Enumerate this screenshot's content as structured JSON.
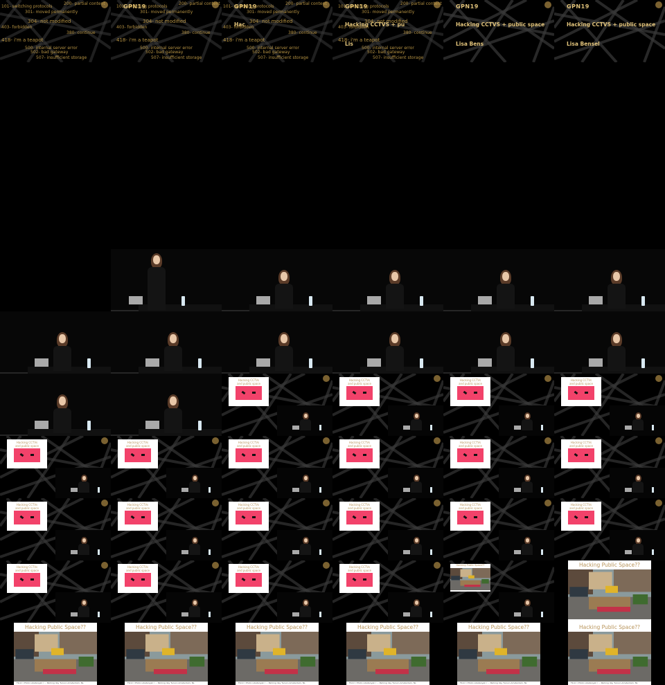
{
  "sheet": {
    "columns": 6,
    "rows": 11
  },
  "title_frames": [
    {
      "gpn": "",
      "line1": "",
      "line2": "",
      "codes": true
    },
    {
      "gpn": "GPN19",
      "line1": "",
      "line2": "",
      "codes": true
    },
    {
      "gpn": "GPN19",
      "line1": "Hac",
      "line2": "",
      "codes": true
    },
    {
      "gpn": "GPN19",
      "line1": "Hacking CCTVS + pu",
      "line2": "Lis",
      "codes": true
    },
    {
      "gpn": "GPN19",
      "line1": "Hacking CCTVS + public space",
      "line2": "Lisa Bens",
      "codes": false
    },
    {
      "gpn": "GPN19",
      "line1": "Hacking CCTVS + public space",
      "line2": "Lisa Bensel",
      "codes": false
    }
  ],
  "http_codes": [
    "200- partial content",
    "301- moved permanently",
    "304- not modified",
    "380- continue",
    "418- i'm a teapot",
    "500- internal server error",
    "502- bad gateway",
    "507- insufficient storage",
    "101- switching protocols",
    "403- forbidden"
  ],
  "poster": {
    "title_line1": "Hacking CCTVs",
    "title_line2": "and public space"
  },
  "public_space": {
    "title": "Hacking Public Space??",
    "caption": "Flickr / Photo Libatanyak / ... Parking day Tucson Amsterdam, NL"
  },
  "colors": {
    "background": "#000000",
    "accent_gold": "#e0c27a",
    "poster_red": "#f2426a",
    "poster_title": "#b8945a"
  }
}
